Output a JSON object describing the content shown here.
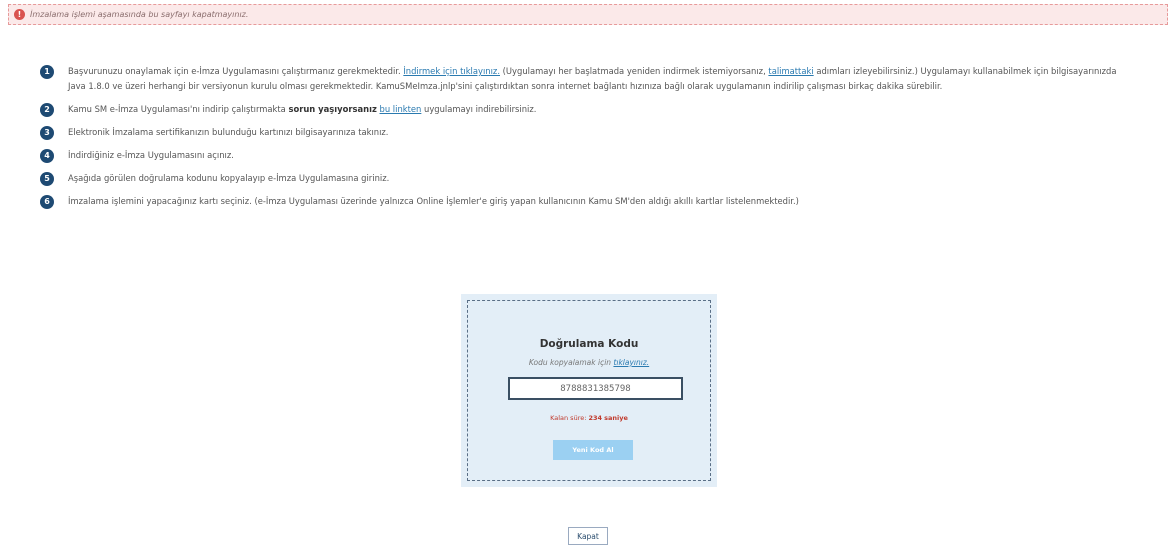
{
  "warning": {
    "icon": "exclamation-icon",
    "text": "İmzalama işlemi aşamasında bu sayfayı kapatmayınız."
  },
  "steps": [
    {
      "number": "1",
      "text_before": "Başvurunuzu onaylamak için e-İmza Uygulamasını çalıştırmanız gerekmektedir. ",
      "link1": "İndirmek için tıklayınız.",
      "text_mid": " (Uygulamayı her başlatmada yeniden indirmek istemiyorsanız, ",
      "link2": "talimattaki",
      "text_after": " adımları izleyebilirsiniz.) Uygulamayı kullanabilmek için bilgisayarınızda Java 1.8.0 ve üzeri herhangi bir versiyonun kurulu olması gerekmektedir. KamuSMeImza.jnlp'sini çalıştırdıktan sonra internet bağlantı hızınıza bağlı olarak uygulamanın indirilip çalışması birkaç dakika sürebilir."
    },
    {
      "number": "2",
      "text_before": "Kamu SM e-İmza Uygulaması'nı indirip çalıştırmakta ",
      "bold": "sorun yaşıyorsanız",
      "text_mid": " ",
      "link": "bu linkten",
      "text_after": " uygulamayı indirebilirsiniz."
    },
    {
      "number": "3",
      "text": "Elektronik İmzalama sertifikanızın bulunduğu kartınızı bilgisayarınıza takınız."
    },
    {
      "number": "4",
      "text": "İndirdiğiniz e-İmza Uygulamasını açınız."
    },
    {
      "number": "5",
      "text": "Aşağıda görülen doğrulama kodunu kopyalayıp e-İmza Uygulamasına giriniz."
    },
    {
      "number": "6",
      "text": "İmzalama işlemini yapacağınız kartı seçiniz. (e-İmza Uygulaması üzerinde yalnızca Online İşlemler'e giriş yapan kullanıcının Kamu SM'den aldığı akıllı kartlar listelenmektedir.)"
    }
  ],
  "verification": {
    "title": "Doğrulama Kodu",
    "hint": "Kodu kopyalamak için",
    "hint_link": "tıklayınız.",
    "code_value": "8788831385798",
    "remaining_label": "Kalan süre:",
    "remaining_seconds": "234",
    "remaining_unit": "saniye",
    "new_code_button": "Yeni Kod Al"
  },
  "close_button": "Kapat",
  "colors": {
    "warning_bg": "#fbe9e9",
    "warning_icon": "#d9534f",
    "step_badge": "#1e4a73",
    "link": "#2a7ab0",
    "code_panel": "#e3eef7",
    "remaining": "#c0392b",
    "new_code_button": "#9bd0f2"
  }
}
